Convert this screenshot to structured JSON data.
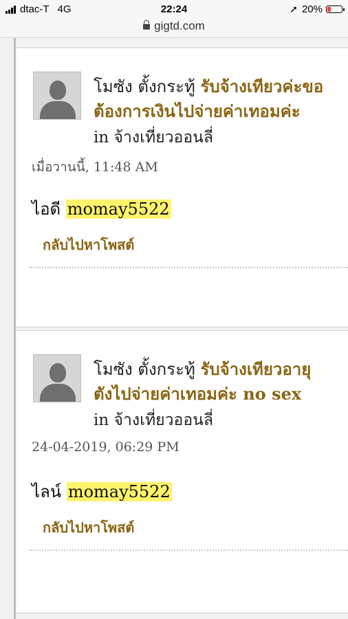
{
  "status_bar": {
    "carrier": "dtac-T",
    "network": "4G",
    "time": "22:24",
    "battery": "20%"
  },
  "browser": {
    "url": "gigtd.com"
  },
  "posts": [
    {
      "author": "โมซัง",
      "verb": "ตั้งกระทู้",
      "title_line1": "รับจ้างเทียวค่ะขอ",
      "title_line2": "ต้องการเงินไปจ่ายค่าเทอมค่ะ",
      "in_label": "in",
      "forum": "จ้างเที่ยวออนลี่",
      "date": "เมื่อวานนี้, 11:48 AM",
      "body_label": "ไอดี",
      "body_value": "momay5522",
      "back_link": "กลับไปหาโพสต์"
    },
    {
      "author": "โมซัง",
      "verb": "ตั้งกระทู้",
      "title_line1": "รับจ้างเทียวอายุ",
      "title_line2": "ตังไปจ่ายค่าเทอมค่ะ no sex",
      "in_label": "in",
      "forum": "จ้างเที่ยวออนลี่",
      "date": "24-04-2019, 06:29 PM",
      "body_label": "ไลน์",
      "body_value": "momay5522",
      "back_link": "กลับไปหาโพสต์"
    }
  ],
  "colors": {
    "link": "#8a6514",
    "highlight": "#fff36b",
    "battery_low": "#ff3b30"
  }
}
